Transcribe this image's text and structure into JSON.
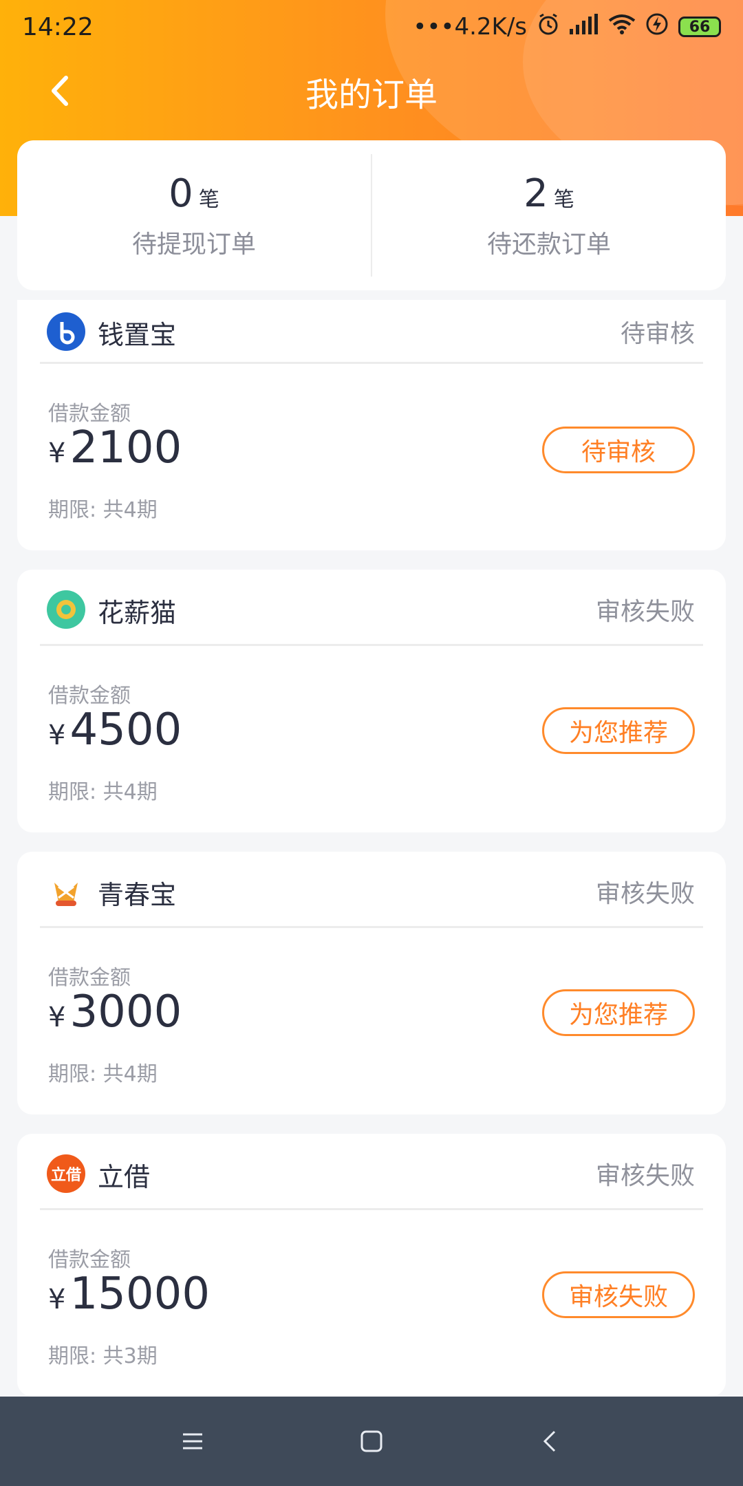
{
  "status_bar": {
    "time": "14:22",
    "net_speed": "•••4.2K/s",
    "battery": "66"
  },
  "header": {
    "title": "我的订单"
  },
  "summary": [
    {
      "count": "0",
      "unit": "笔",
      "label": "待提现订单"
    },
    {
      "count": "2",
      "unit": "笔",
      "label": "待还款订单"
    }
  ],
  "orders": [
    {
      "name": "钱置宝",
      "status": "待审核",
      "amount_label": "借款金额",
      "currency": "¥",
      "amount": "2100",
      "term": "期限: 共4期",
      "button": "待审核",
      "logo_color": "#1e5fd0"
    },
    {
      "name": "花薪猫",
      "status": "审核失败",
      "amount_label": "借款金额",
      "currency": "¥",
      "amount": "4500",
      "term": "期限: 共4期",
      "button": "为您推荐",
      "logo_color": "#3ec7a0"
    },
    {
      "name": "青春宝",
      "status": "审核失败",
      "amount_label": "借款金额",
      "currency": "¥",
      "amount": "3000",
      "term": "期限: 共4期",
      "button": "为您推荐",
      "logo_color": "#f2a22c"
    },
    {
      "name": "立借",
      "status": "审核失败",
      "amount_label": "借款金额",
      "currency": "¥",
      "amount": "15000",
      "term": "期限: 共3期",
      "button": "审核失败",
      "logo_color": "#f05a1a",
      "logo_text": "立借"
    }
  ]
}
